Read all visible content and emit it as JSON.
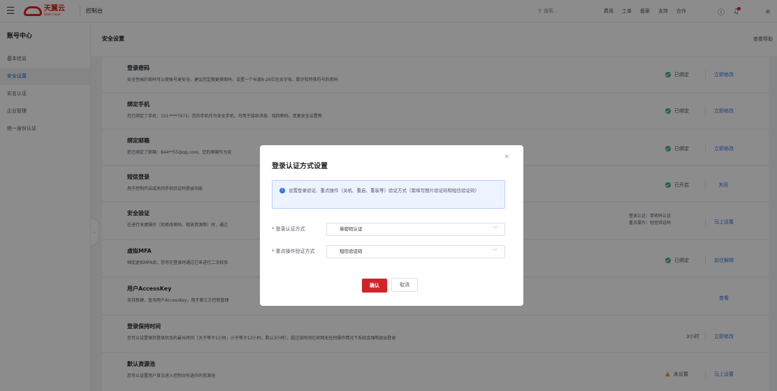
{
  "topbar": {
    "logo_cn": "天翼云",
    "logo_en": "State Cloud",
    "console": "控制台",
    "search_placeholder": "搜索...",
    "links": [
      "费用",
      "工单",
      "备案",
      "支持",
      "合作"
    ],
    "account": "柳"
  },
  "sidebar": {
    "title": "账号中心",
    "items": [
      {
        "label": "基本信息",
        "active": false
      },
      {
        "label": "安全设置",
        "active": true
      },
      {
        "label": "实名认证",
        "active": false
      },
      {
        "label": "企业管理",
        "active": false
      },
      {
        "label": "统一身份认证",
        "active": false
      }
    ]
  },
  "header": {
    "title": "安全设置",
    "help": "查看帮助"
  },
  "rows": [
    {
      "title": "登录密码",
      "desc": "安全性高的密码可以使账号更安全。建议您定期更换密码，设置一个长度8-26位包含字母、数字和特殊符号的密码",
      "status": "已绑定",
      "action": "立即修改"
    },
    {
      "title": "绑定手机",
      "desc": "您已绑定了手机：151****7973。您的手机作为安全手机，可用于接收消息、找回密码、变更安全设置等",
      "status": "已绑定",
      "action": "立即修改"
    },
    {
      "title": "绑定邮箱",
      "desc": "您已绑定了邮箱：844**55@qq.com。您的邮箱作为安",
      "status": "已绑定",
      "action": "立即修改"
    },
    {
      "title": "短信登录",
      "desc": "用于控制开启或关闭手机验证码登录功能",
      "status": "已开启",
      "action": "关闭"
    },
    {
      "title": "安全验证",
      "desc": "在进行关键操作（如修改密码、释放资源等）时，通过",
      "status_lines": [
        "登录认证：单密码认证",
        "重点操作：短信验证码"
      ],
      "action": "马上设置"
    },
    {
      "title": "虚拟MFA",
      "desc": "绑定虚拟MFA后，您可在登录时通过它来进行二次校验",
      "status": "已绑定",
      "action": "前往解绑"
    },
    {
      "title": "用户AccessKey",
      "desc": "支持新建、查询用户AccessKey，用于第三方控制管理",
      "action": "查看"
    },
    {
      "title": "登录保持时间",
      "desc": "您可以设置保持登录状态的最长时间（大于等于1小时，小于等于12小时，默认3小时），超过该时间在官网无任何操作情况下系统会强制退出登录",
      "status": "3小时",
      "action": "立即修改"
    },
    {
      "title": "默认资源池",
      "desc": "您可以设置用户首次进入控制台所选中的资源池",
      "status": "未设置",
      "action": "马上设置"
    }
  ],
  "modal": {
    "title": "登录认证方式设置",
    "info": "设置登录验证、重点操作（关机、重启、重装等）验证方式（需填写图片验证码和短信验证码）",
    "fields": [
      {
        "label": "登录认证方式",
        "value": "单密码认证"
      },
      {
        "label": "重点操作验证方式",
        "value": "短信验证码"
      }
    ],
    "confirm": "确认",
    "cancel": "取消"
  },
  "colors": {
    "brand": "#e4231b",
    "link": "#2f73e6",
    "ok": "#3eb370",
    "warn": "#f09a27"
  }
}
